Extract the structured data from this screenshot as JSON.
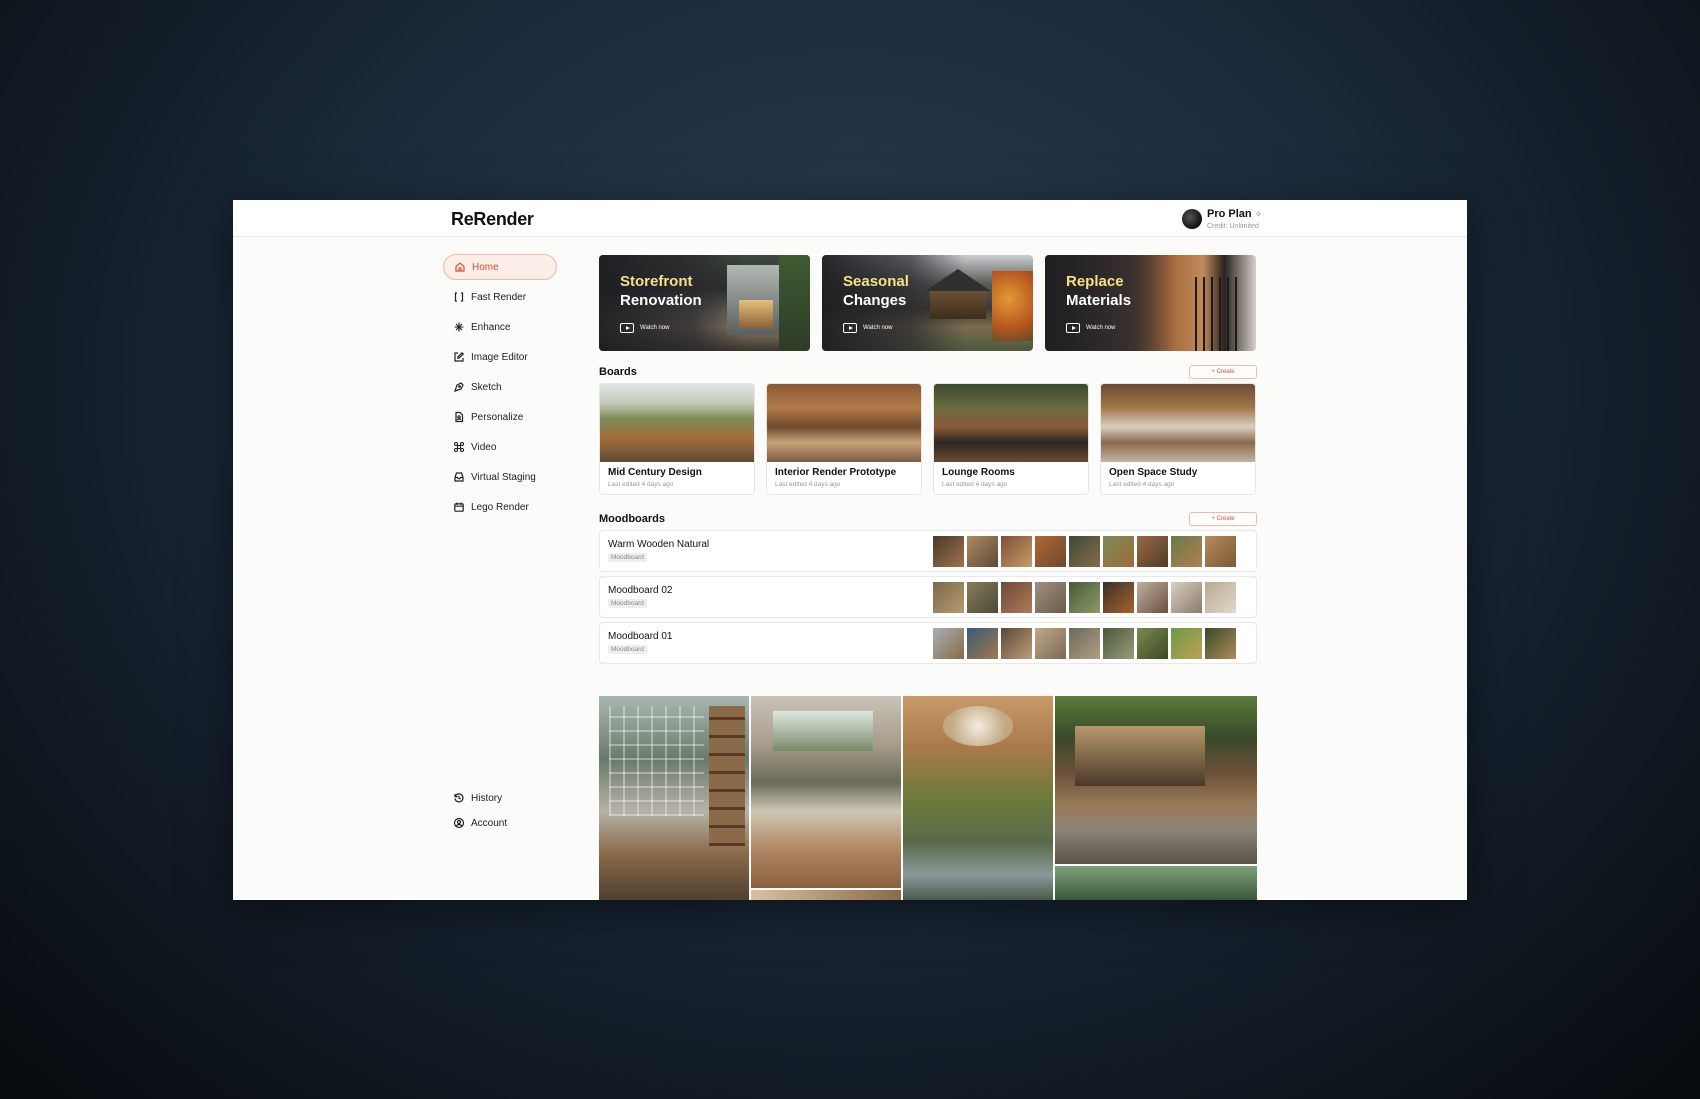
{
  "app": {
    "logo": "ReRender"
  },
  "account": {
    "plan": "Pro Plan",
    "spark": "✧",
    "credit": "Credit: Unlimited"
  },
  "nav": {
    "items": [
      {
        "label": "Home",
        "icon": "home-icon",
        "active": true
      },
      {
        "label": "Fast Render",
        "icon": "brackets-icon"
      },
      {
        "label": "Enhance",
        "icon": "sparkle-icon"
      },
      {
        "label": "Image Editor",
        "icon": "edit-icon"
      },
      {
        "label": "Sketch",
        "icon": "pen-tool-icon"
      },
      {
        "label": "Personalize",
        "icon": "person-doc-icon"
      },
      {
        "label": "Video",
        "icon": "command-icon"
      },
      {
        "label": "Virtual Staging",
        "icon": "inbox-icon"
      },
      {
        "label": "Lego Render",
        "icon": "calendar-icon"
      }
    ],
    "bottom": [
      {
        "label": "History",
        "icon": "history-icon"
      },
      {
        "label": "Account",
        "icon": "user-circle-icon"
      }
    ]
  },
  "heroes": [
    {
      "line1": "Storefront",
      "line2": "Renovation",
      "watch": "Watch now"
    },
    {
      "line1": "Seasonal",
      "line2": "Changes",
      "watch": "Watch now"
    },
    {
      "line1": "Replace",
      "line2": "Materials",
      "watch": "Watch now"
    }
  ],
  "boards": {
    "title": "Boards",
    "create": "+ Create",
    "items": [
      {
        "name": "Mid Century Design",
        "meta": "Last edited 4 days ago"
      },
      {
        "name": "Interior Render Prototype",
        "meta": "Last edited 4 days ago"
      },
      {
        "name": "Lounge Rooms",
        "meta": "Last edited 4 days ago"
      },
      {
        "name": "Open Space Study",
        "meta": "Last edited 4 days ago"
      }
    ]
  },
  "moodboards": {
    "title": "Moodboards",
    "create": "+ Create",
    "items": [
      {
        "name": "Warm Wooden Natural",
        "tag": "Moodboard"
      },
      {
        "name": "Moodboard 02",
        "tag": "Moodboard"
      },
      {
        "name": "Moodboard 01",
        "tag": "Moodboard"
      }
    ]
  },
  "colors": {
    "accent": "#d4502e",
    "accent_bg": "#fbeee9",
    "hero_title": "#f3e18a"
  }
}
